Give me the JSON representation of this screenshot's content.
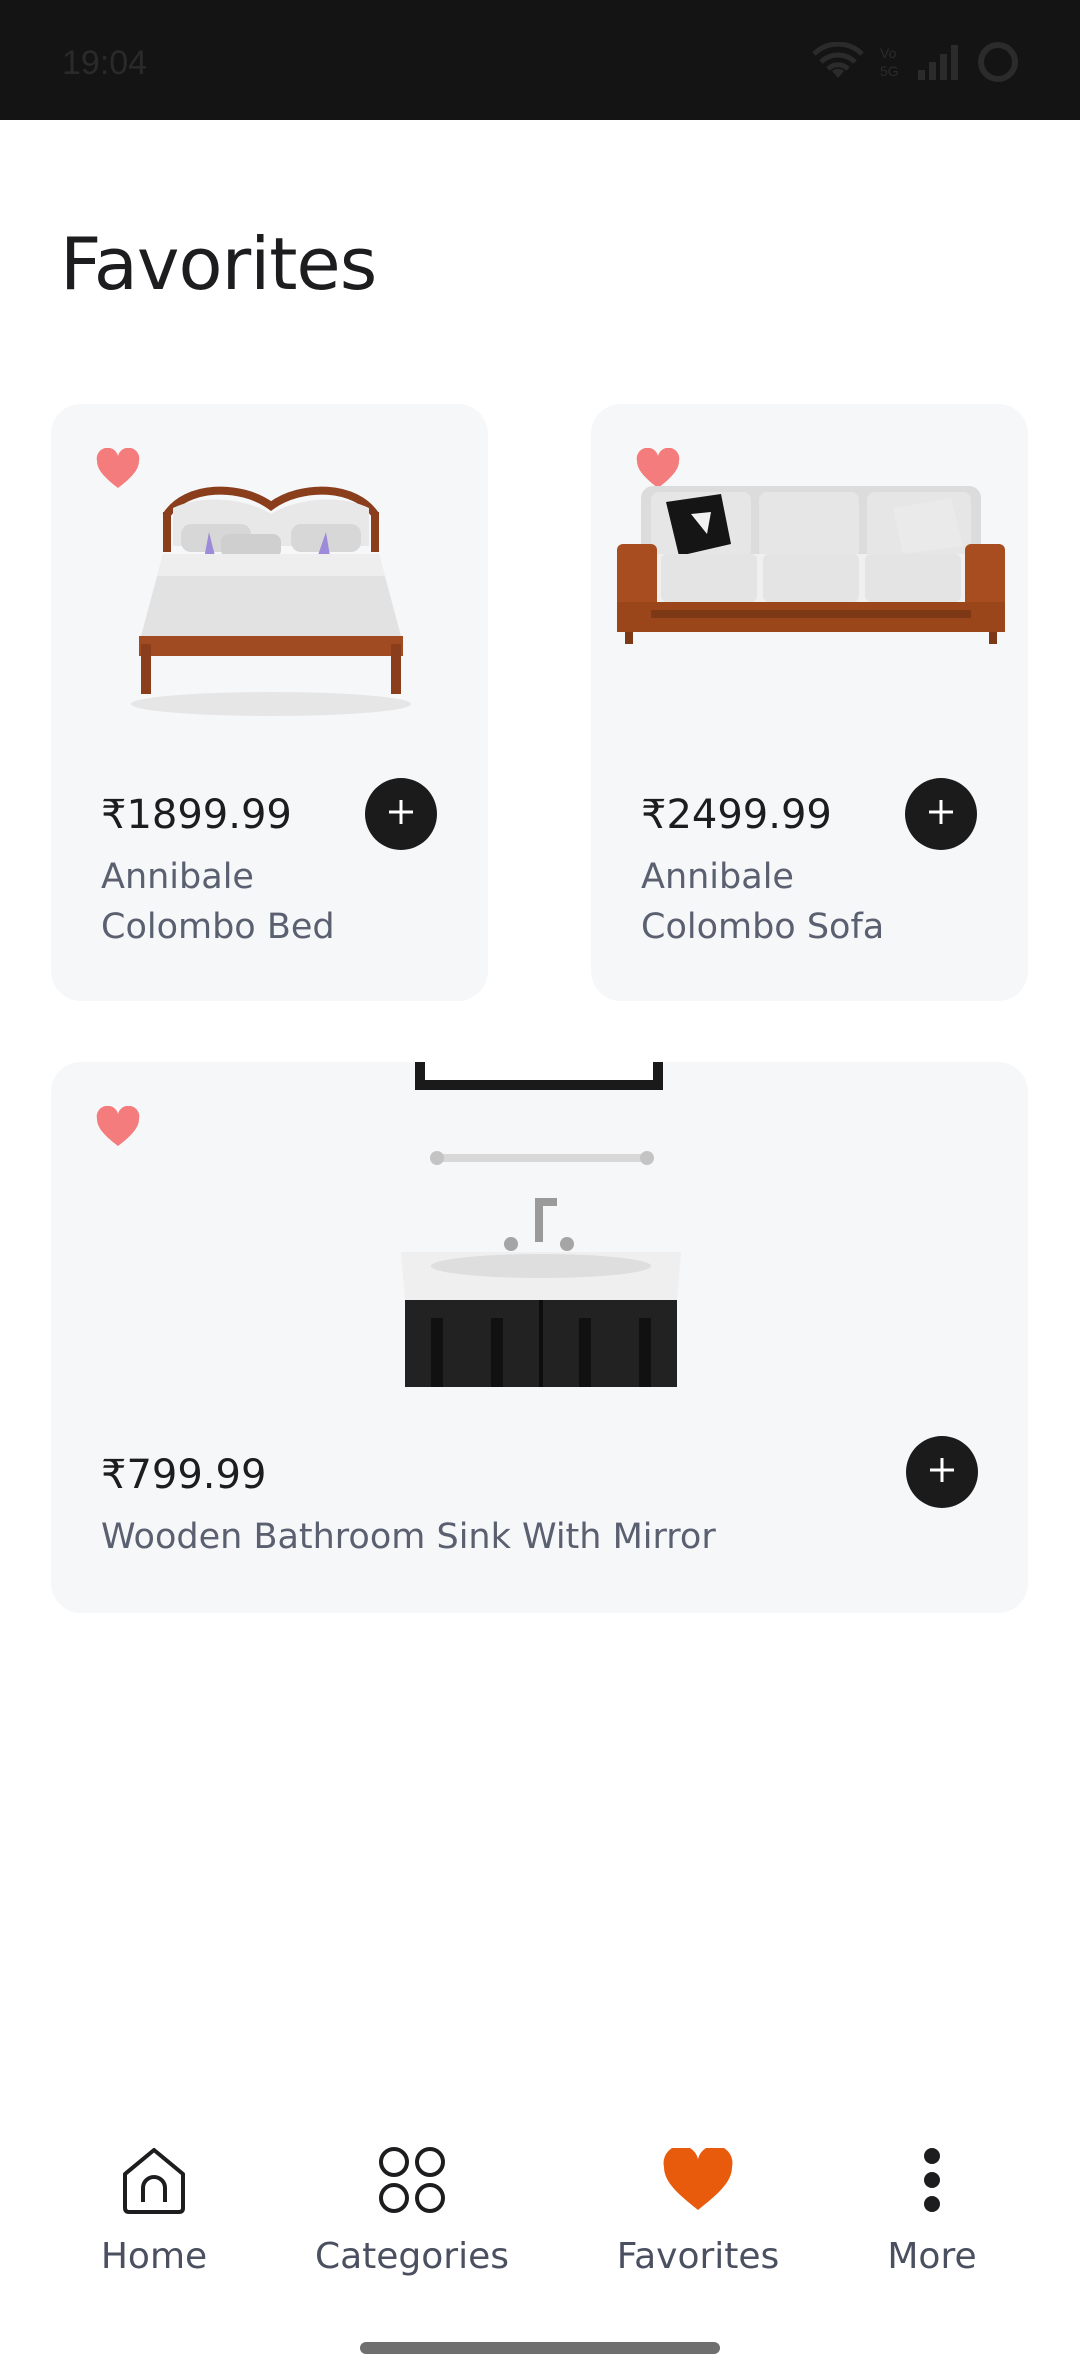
{
  "status_bar": {
    "time": "19:04",
    "icons": [
      "wifi-icon",
      "volte-icon",
      "signal-icon",
      "battery-ring-icon"
    ]
  },
  "page": {
    "title": "Favorites"
  },
  "products": [
    {
      "price": "₹1899.99",
      "name_line1": "Annibale",
      "name_line2": "Colombo Bed",
      "image": "bed-image",
      "favorite": true
    },
    {
      "price": "₹2499.99",
      "name_line1": "Annibale",
      "name_line2": "Colombo Sofa",
      "image": "sofa-image",
      "favorite": true
    },
    {
      "price": "₹799.99",
      "name_line1": "Wooden Bathroom Sink With Mirror",
      "image": "sink-image",
      "favorite": true
    }
  ],
  "bottom_nav": {
    "items": [
      {
        "label": "Home",
        "icon": "home-icon",
        "active": false
      },
      {
        "label": "Categories",
        "icon": "categories-icon",
        "active": false
      },
      {
        "label": "Favorites",
        "icon": "heart-icon",
        "active": true
      },
      {
        "label": "More",
        "icon": "more-vertical-icon",
        "active": false
      }
    ]
  },
  "colors": {
    "accent": "#e85a0c",
    "favorite_heart": "#f47c7c",
    "card_bg": "#f6f7f9",
    "status_bar_bg": "#141414",
    "add_button_bg": "#1b1b1b"
  }
}
